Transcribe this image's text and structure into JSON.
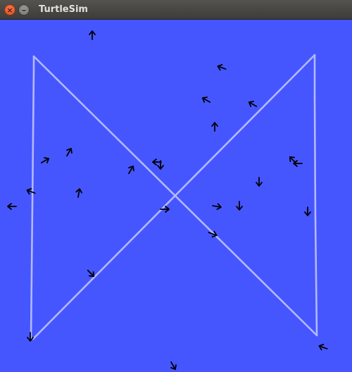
{
  "window": {
    "title": "TurtleSim",
    "close_glyph": "×",
    "minimize_glyph": "–",
    "close_icon": "close-icon",
    "minimize_icon": "minimize-icon"
  },
  "canvas": {
    "background_color": "#4556ff",
    "pen_color": "#b3b8ff",
    "turtle_color": "#000000",
    "turtle_icon": "turtle-arrow-icon"
  }
}
